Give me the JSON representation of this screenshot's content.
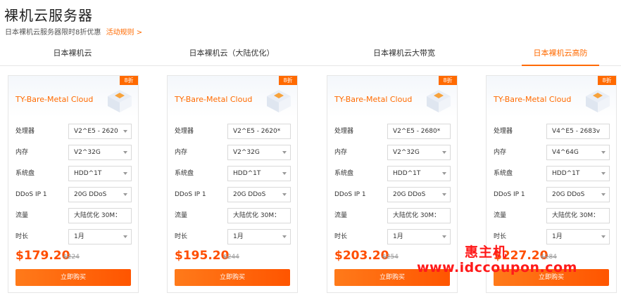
{
  "header": {
    "title": "裸机云服务器",
    "promo_text": "日本裸机云服务器限时8折优惠",
    "rules_link": "活动规则 >"
  },
  "tabs": [
    {
      "label": "日本裸机云",
      "active": false
    },
    {
      "label": "日本裸机云（大陆优化）",
      "active": false
    },
    {
      "label": "日本裸机云大带宽",
      "active": false
    },
    {
      "label": "日本裸机云高防",
      "active": true
    }
  ],
  "labels": {
    "cpu": "处理器",
    "memory": "内存",
    "disk": "系统盘",
    "ddos": "DDoS IP 1",
    "traffic": "流量",
    "duration": "时长"
  },
  "cards": [
    {
      "badge": "8折",
      "title": "TY-Bare-Metal Cloud",
      "cpu": "V2^E5 - 2620",
      "memory": "V2^32G",
      "disk": "HDD^1T",
      "ddos": "20G DDoS",
      "traffic": "大陆优化 30M：",
      "duration": "1月",
      "price": "$179.20",
      "original": "$224",
      "buy": "立即购买"
    },
    {
      "badge": "8折",
      "title": "TY-Bare-Metal Cloud",
      "cpu": "V2^E5 - 2620*",
      "memory": "V2^32G",
      "disk": "HDD^1T",
      "ddos": "20G DDoS",
      "traffic": "大陆优化 30M：",
      "duration": "1月",
      "price": "$195.20",
      "original": "$244",
      "buy": "立即购买"
    },
    {
      "badge": "8折",
      "title": "TY-Bare-Metal Cloud",
      "cpu": "V2^E5 - 2680*",
      "memory": "V2^32G",
      "disk": "HDD^1T",
      "ddos": "20G DDoS",
      "traffic": "大陆优化 30M：",
      "duration": "1月",
      "price": "$203.20",
      "original": "$254",
      "buy": "立即购买"
    },
    {
      "badge": "8折",
      "title": "TY-Bare-Metal Cloud",
      "cpu": "V4^E5 - 2683v",
      "memory": "V4^64G",
      "disk": "HDD^1T",
      "ddos": "20G DDoS",
      "traffic": "大陆优化 30M：",
      "duration": "1月",
      "price": "$227.20",
      "original": "$284",
      "buy": "立即购买"
    }
  ],
  "watermark": {
    "title": "惠主机",
    "url": "www.idccoupon.com"
  },
  "colors": {
    "accent": "#ff6a00",
    "price": "#ff4e00",
    "watermark": "#ff1a1a"
  }
}
